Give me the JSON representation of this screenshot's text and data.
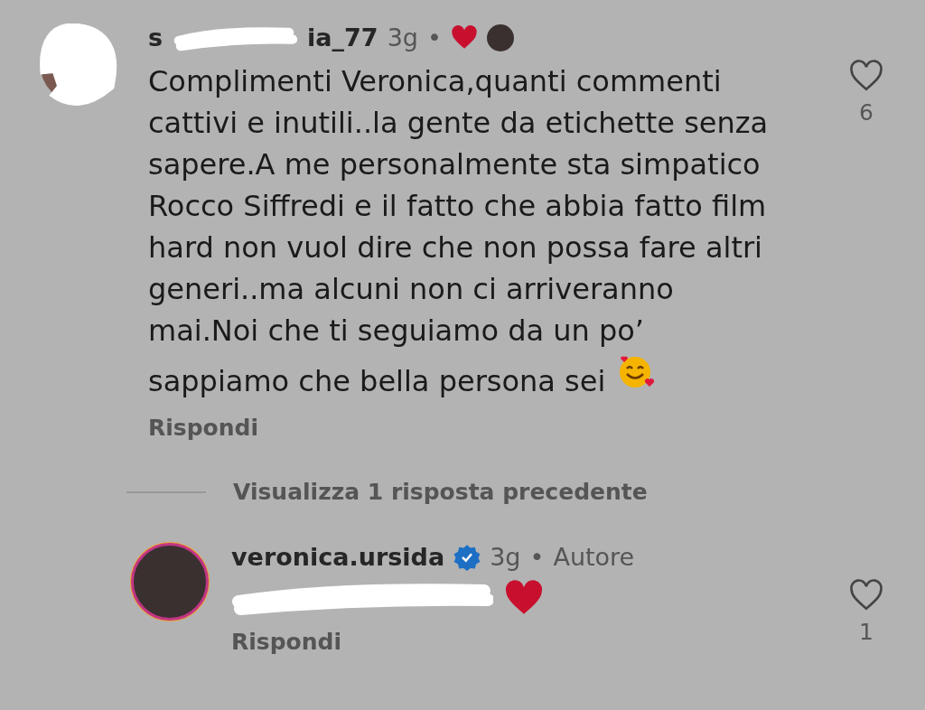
{
  "comments": [
    {
      "username_start": "s",
      "username_end": "ia_77",
      "username_redacted": true,
      "time": "3g",
      "separator": "•",
      "liked_by_author": true,
      "verified": false,
      "text": "Complimenti Veronica,quanti commenti\ncattivi e inutili..la gente da etichette senza\nsapere.A me personalmente sta simpatico\nRocco Siffredi e il fatto che abbia fatto film\nhard non vuol dire che non possa fare altri\ngeneri..ma alcuni non ci arriveranno\nmai.Noi che ti seguiamo da un po’\nsappiamo che bella persona sei",
      "smile_emoji": true,
      "reply_label": "Rispondi",
      "likes": "6"
    },
    {
      "username_start": "veronica.ursida",
      "username_redacted": false,
      "time": "3g",
      "separator": "•",
      "liked_by_author": false,
      "verified": true,
      "author_label": "Autore",
      "mention_redacted": true,
      "heart_emoji": true,
      "reply_label": "Rispondi",
      "likes": "1"
    }
  ],
  "view_replies": "Visualizza 1 risposta precedente"
}
